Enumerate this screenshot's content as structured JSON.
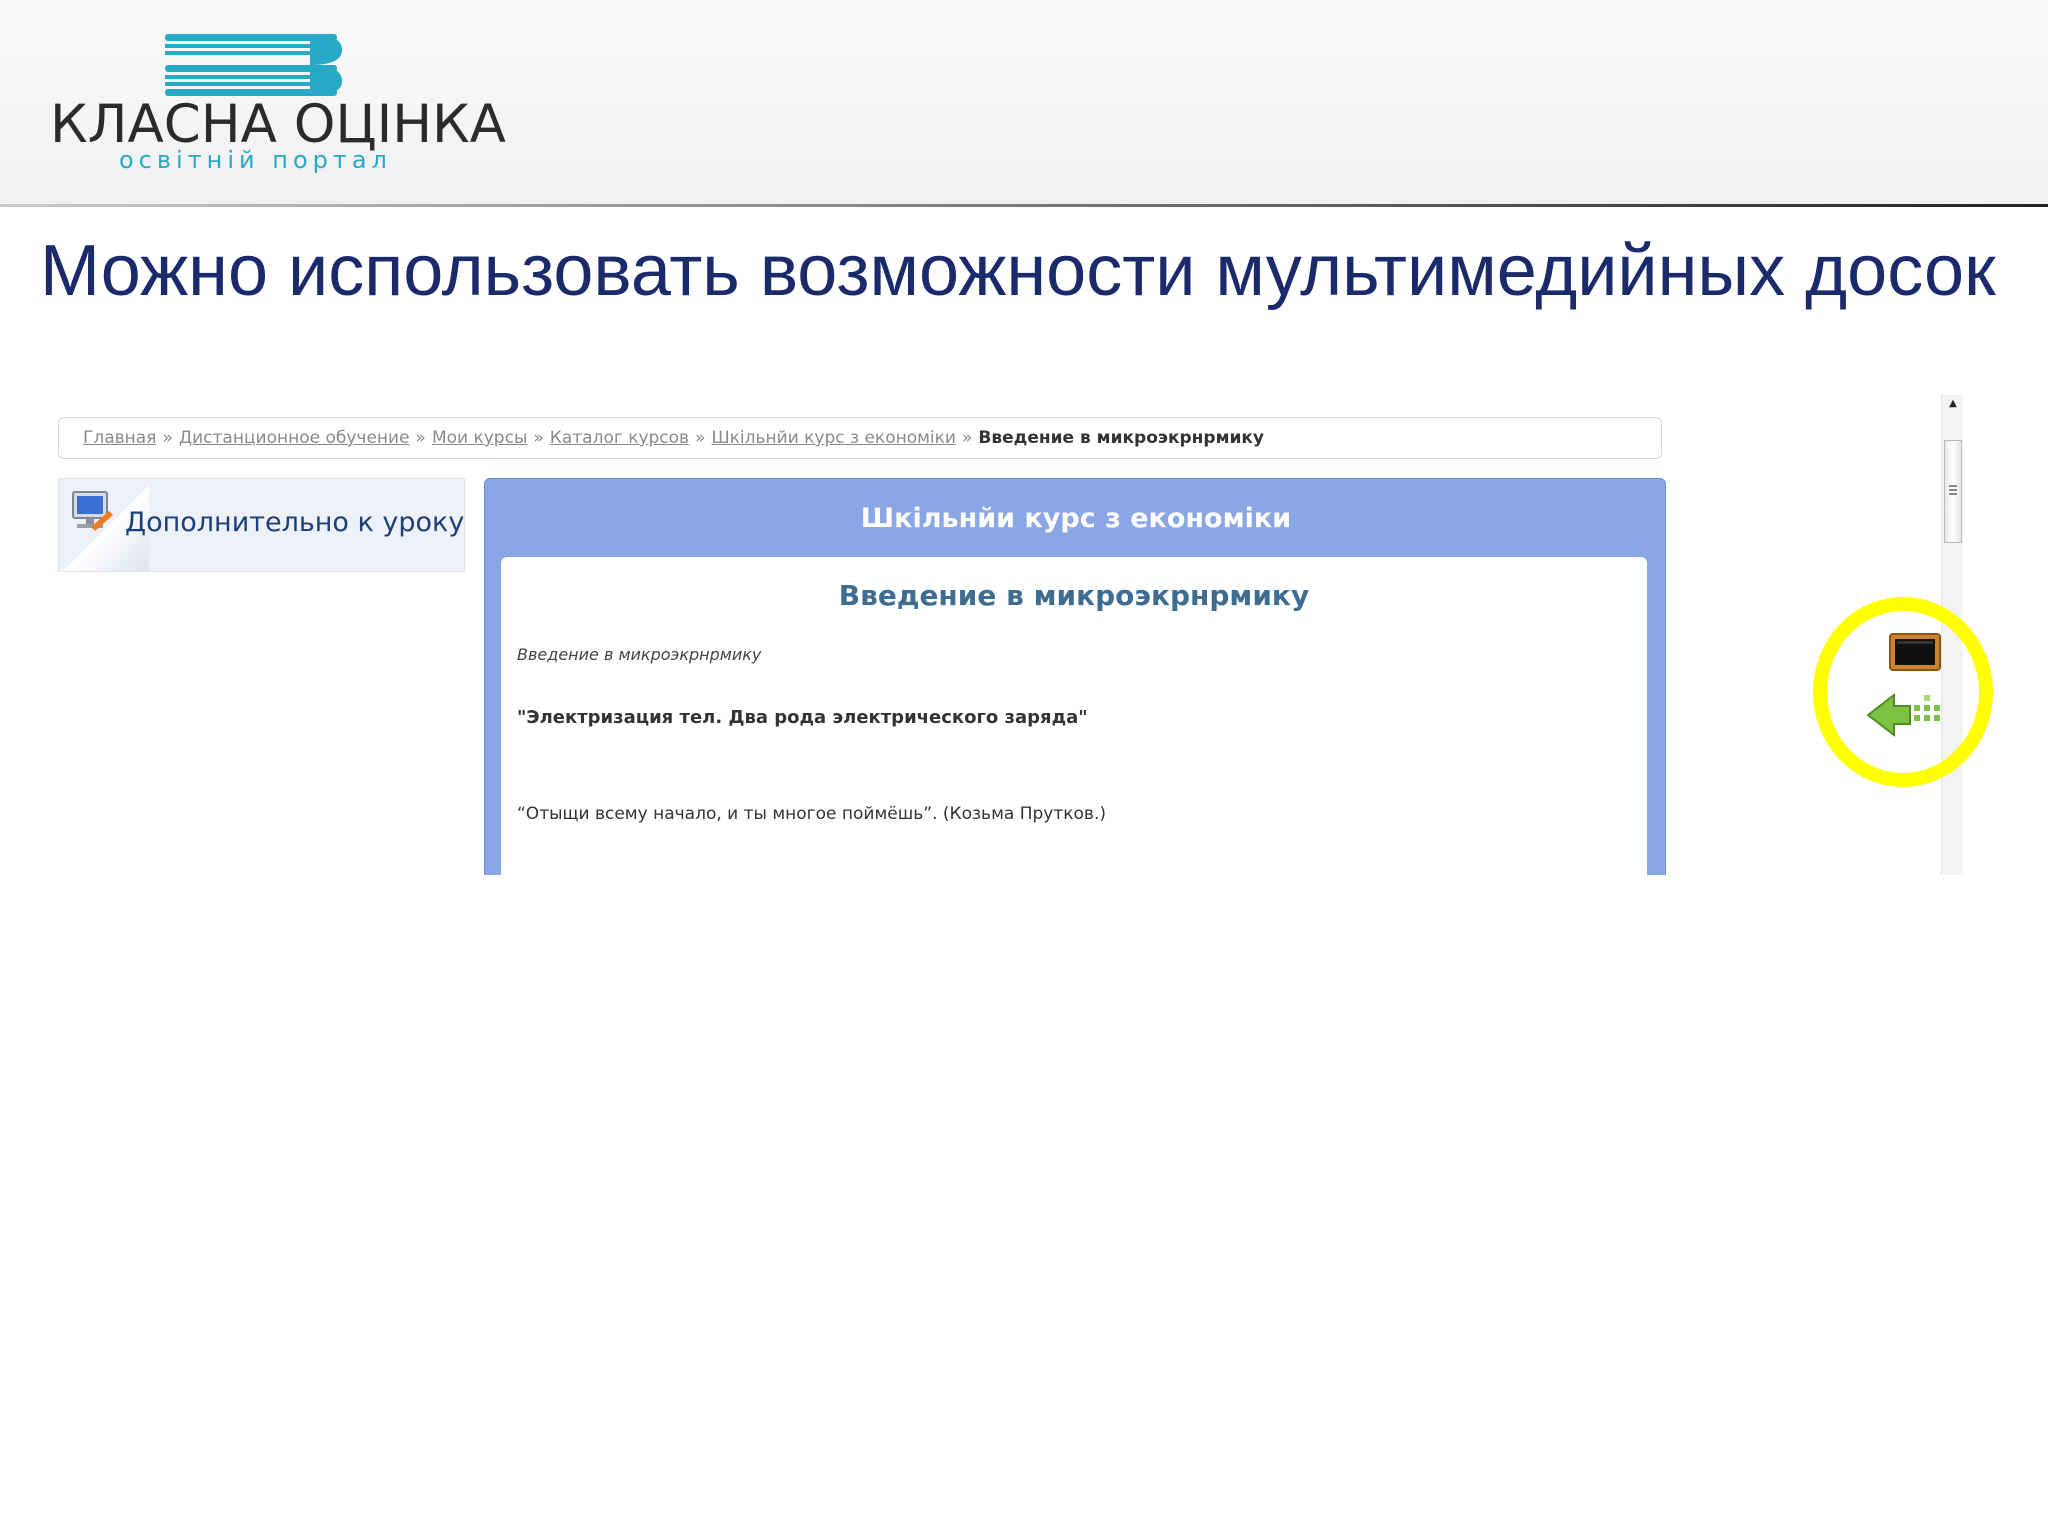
{
  "logo": {
    "title": "КЛАСНА ОЦІНКА",
    "subtitle": "освітній портал",
    "accent_color": "#29a9c8"
  },
  "slide": {
    "title": "Можно использовать возможности мультимедийных досок",
    "title_color": "#1a2a6b"
  },
  "breadcrumb": {
    "items": [
      "Главная",
      "Дистанционное обучение",
      "Мои курсы",
      "Каталог курсов",
      "Шкільнйи курс з економіки"
    ],
    "separator": "»",
    "current": "Введение в микроэкрнрмику"
  },
  "sidebar": {
    "extra_label": "Дополнительно к уроку",
    "icon": "monitor-icon"
  },
  "course": {
    "title": "Шкільнйи курс з економіки",
    "panel_color": "#8aa6e4",
    "lesson": {
      "heading": "Введение в микроэкрнрмику",
      "subtitle": "Введение в микроэкрнрмику",
      "topic": "\"Электризация тел. Два рода электрического заряда\"",
      "quote": "“Отыщи всему начало, и ты многое поймёшь”. (Козьма Прутков.)"
    }
  },
  "board_tools": {
    "board_icon": "whiteboard-icon",
    "back_icon": "back-arrow-icon",
    "highlight_color": "#ffff00"
  }
}
